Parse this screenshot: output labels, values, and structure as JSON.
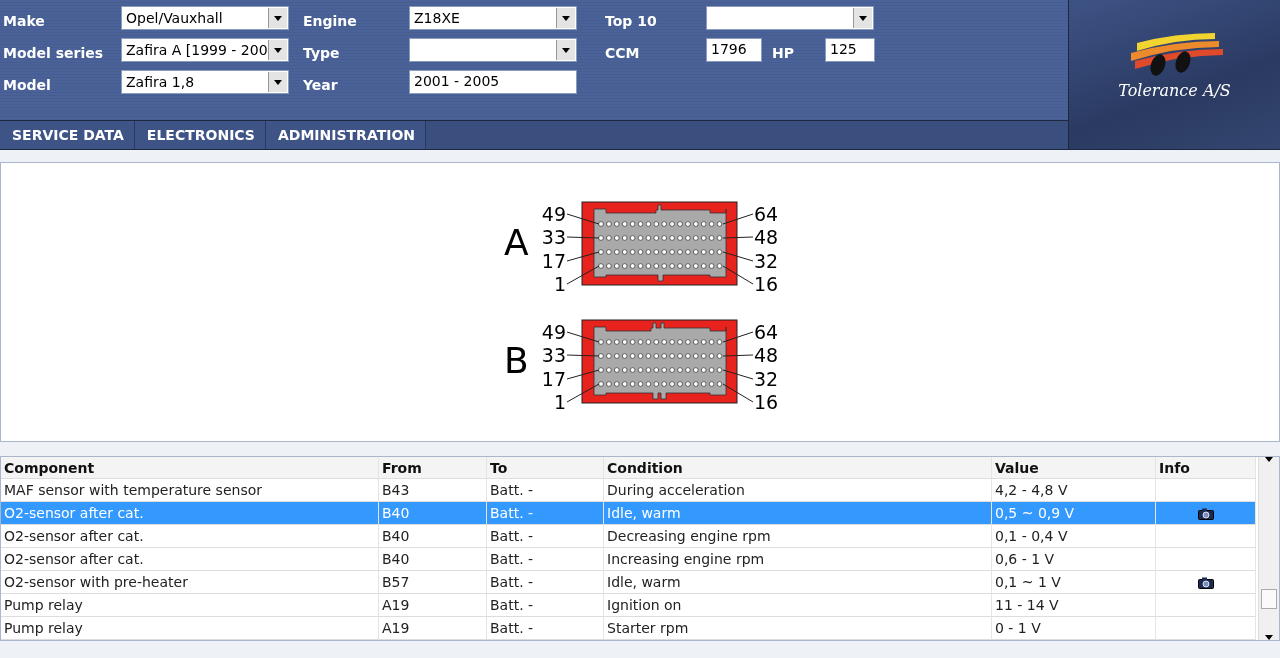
{
  "header": {
    "columns": [
      [
        {
          "label": "Make",
          "kind": "select",
          "value": "Opel/Vauxhall"
        },
        {
          "label": "Model series",
          "kind": "select",
          "value": "Zafira A [1999 - 200"
        },
        {
          "label": "Model",
          "kind": "select",
          "value": "Zafira 1,8"
        }
      ],
      [
        {
          "label": "Engine",
          "kind": "select",
          "value": "Z18XE"
        },
        {
          "label": "Type",
          "kind": "select"
        },
        {
          "label": "Year",
          "kind": "text",
          "value": "2001 - 2005"
        }
      ],
      [
        {
          "label": "Top 10",
          "kind": "select"
        },
        {
          "label": "CCM",
          "kind": "pair",
          "value": "1796",
          "second_label": "HP",
          "second_value": "125"
        }
      ]
    ],
    "logo": {
      "text": "Tolerance A/S"
    }
  },
  "nav": [
    "SERVICE DATA",
    "ELECTRONICS",
    "ADMINISTRATION"
  ],
  "connectors": [
    {
      "letter": "A",
      "left_pins": [
        "49",
        "33",
        "17",
        "1"
      ],
      "right_pins": [
        "64",
        "48",
        "32",
        "16"
      ]
    },
    {
      "letter": "B",
      "left_pins": [
        "49",
        "33",
        "17",
        "1"
      ],
      "right_pins": [
        "64",
        "48",
        "32",
        "16"
      ]
    }
  ],
  "table": {
    "columns": [
      "Component",
      "From",
      "To",
      "Condition",
      "Value",
      "Info"
    ],
    "rows": [
      {
        "component": "MAF sensor with temperature sensor",
        "from": "B43",
        "to": "Batt. -",
        "condition": "During acceleration",
        "value": "4,2 - 4,8 V",
        "has_info": false,
        "selected": false
      },
      {
        "component": "O2-sensor after cat.",
        "from": "B40",
        "to": "Batt. -",
        "condition": "Idle, warm",
        "value": "0,5 ~ 0,9 V",
        "has_info": true,
        "selected": true
      },
      {
        "component": "O2-sensor after cat.",
        "from": "B40",
        "to": "Batt. -",
        "condition": "Decreasing engine rpm",
        "value": "0,1 - 0,4 V",
        "has_info": false,
        "selected": false
      },
      {
        "component": "O2-sensor after cat.",
        "from": "B40",
        "to": "Batt. -",
        "condition": "Increasing engine rpm",
        "value": "0,6 - 1 V",
        "has_info": false,
        "selected": false
      },
      {
        "component": "O2-sensor with pre-heater",
        "from": "B57",
        "to": "Batt. -",
        "condition": "Idle, warm",
        "value": "0,1 ~ 1 V",
        "has_info": true,
        "selected": false
      },
      {
        "component": "Pump relay",
        "from": "A19",
        "to": "Batt. -",
        "condition": "Ignition on",
        "value": "11 - 14 V",
        "has_info": false,
        "selected": false
      },
      {
        "component": "Pump relay",
        "from": "A19",
        "to": "Batt. -",
        "condition": "Starter rpm",
        "value": "0 - 1 V",
        "has_info": false,
        "selected": false
      }
    ]
  }
}
